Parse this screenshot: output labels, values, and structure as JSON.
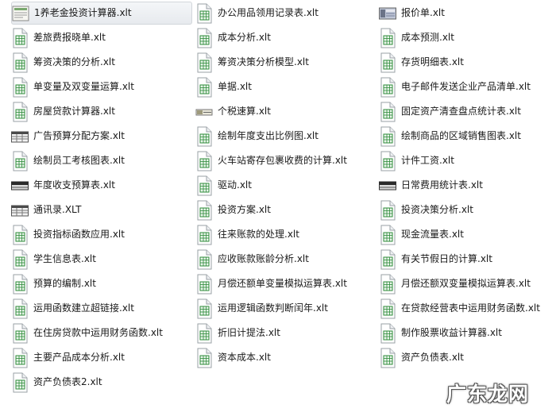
{
  "files": [
    {
      "name": "1养老金投资计算器.xlt",
      "icon": "form-thumbnail-icon",
      "selected": true
    },
    {
      "name": "办公用品领用记录表.xlt",
      "icon": "excel-template-icon"
    },
    {
      "name": "报价单.xlt",
      "icon": "image-thumbnail-icon"
    },
    {
      "name": "差旅费报晓单.xlt",
      "icon": "excel-template-icon"
    },
    {
      "name": "成本分析.xlt",
      "icon": "excel-template-icon"
    },
    {
      "name": "成本预测.xlt",
      "icon": "excel-template-icon"
    },
    {
      "name": "筹资决策的分析.xlt",
      "icon": "excel-template-icon"
    },
    {
      "name": "筹资决策分析模型.xlt",
      "icon": "excel-template-icon"
    },
    {
      "name": "存货明细表.xlt",
      "icon": "excel-template-icon"
    },
    {
      "name": "单变量及双变量运算.xlt",
      "icon": "excel-template-icon"
    },
    {
      "name": "单据.xlt",
      "icon": "excel-template-icon"
    },
    {
      "name": "电子邮件发送企业产品清单.xlt",
      "icon": "excel-template-icon"
    },
    {
      "name": "房屋贷款计算器.xlt",
      "icon": "excel-template-icon"
    },
    {
      "name": "个税速算.xlt",
      "icon": "small-thumbnail-icon"
    },
    {
      "name": "固定资产清查盘点统计表.xlt",
      "icon": "excel-template-icon"
    },
    {
      "name": "广告预算分配方案.xlt",
      "icon": "sheet-thumbnail-icon"
    },
    {
      "name": "绘制年度支出比例图.xlt",
      "icon": "excel-template-icon"
    },
    {
      "name": "绘制商品的区域销售图表.xlt",
      "icon": "excel-template-icon"
    },
    {
      "name": "绘制员工考核图表.xlt",
      "icon": "excel-template-icon"
    },
    {
      "name": "火车站寄存包裹收费的计算.xlt",
      "icon": "excel-template-icon"
    },
    {
      "name": "计件工资.xlt",
      "icon": "excel-template-icon"
    },
    {
      "name": "年度收支预算表.xlt",
      "icon": "dark-thumbnail-icon"
    },
    {
      "name": "驱动.xlt",
      "icon": "excel-template-icon"
    },
    {
      "name": "日常费用统计表.xlt",
      "icon": "dark-thumbnail-icon"
    },
    {
      "name": "通讯录.XLT",
      "icon": "sheet-thumbnail-icon"
    },
    {
      "name": "投资方案.xlt",
      "icon": "excel-template-icon"
    },
    {
      "name": "投资决策分析.xlt",
      "icon": "excel-template-icon"
    },
    {
      "name": "投资指标函数应用.xlt",
      "icon": "excel-template-icon"
    },
    {
      "name": "往来账款的处理.xlt",
      "icon": "excel-template-icon"
    },
    {
      "name": "现金流量表.xlt",
      "icon": "excel-template-icon"
    },
    {
      "name": "学生信息表.xlt",
      "icon": "excel-template-icon"
    },
    {
      "name": "应收账款账龄分析.xlt",
      "icon": "excel-template-icon"
    },
    {
      "name": "有关节假日的计算.xlt",
      "icon": "excel-template-icon"
    },
    {
      "name": "预算的编制.xlt",
      "icon": "excel-template-icon"
    },
    {
      "name": "月偿还额单变量模拟运算表.xlt",
      "icon": "excel-template-icon"
    },
    {
      "name": "月偿还额双变量模拟运算表.xlt",
      "icon": "excel-template-icon"
    },
    {
      "name": "运用函数建立超链接.xlt",
      "icon": "excel-template-icon"
    },
    {
      "name": "运用逻辑函数判断闰年.xlt",
      "icon": "excel-template-icon"
    },
    {
      "name": "在贷款经营表中运用财务函数.xlt",
      "icon": "excel-template-icon"
    },
    {
      "name": "在住房贷款中运用财务函数.xlt",
      "icon": "excel-template-icon"
    },
    {
      "name": "折旧计提法.xlt",
      "icon": "excel-template-icon"
    },
    {
      "name": "制作股票收益计算器.xlt",
      "icon": "excel-template-icon"
    },
    {
      "name": "主要产品成本分析.xlt",
      "icon": "excel-template-icon"
    },
    {
      "name": "资本成本.xlt",
      "icon": "excel-template-icon"
    },
    {
      "name": "资产负债表.xlt",
      "icon": "excel-template-icon"
    },
    {
      "name": "资产负债表2.xlt",
      "icon": "excel-template-icon"
    }
  ],
  "watermark": "广东龙网",
  "colors": {
    "icon_green": "#2e8b3a",
    "icon_border": "#9aa0a6",
    "selection": "#e7eaee"
  }
}
